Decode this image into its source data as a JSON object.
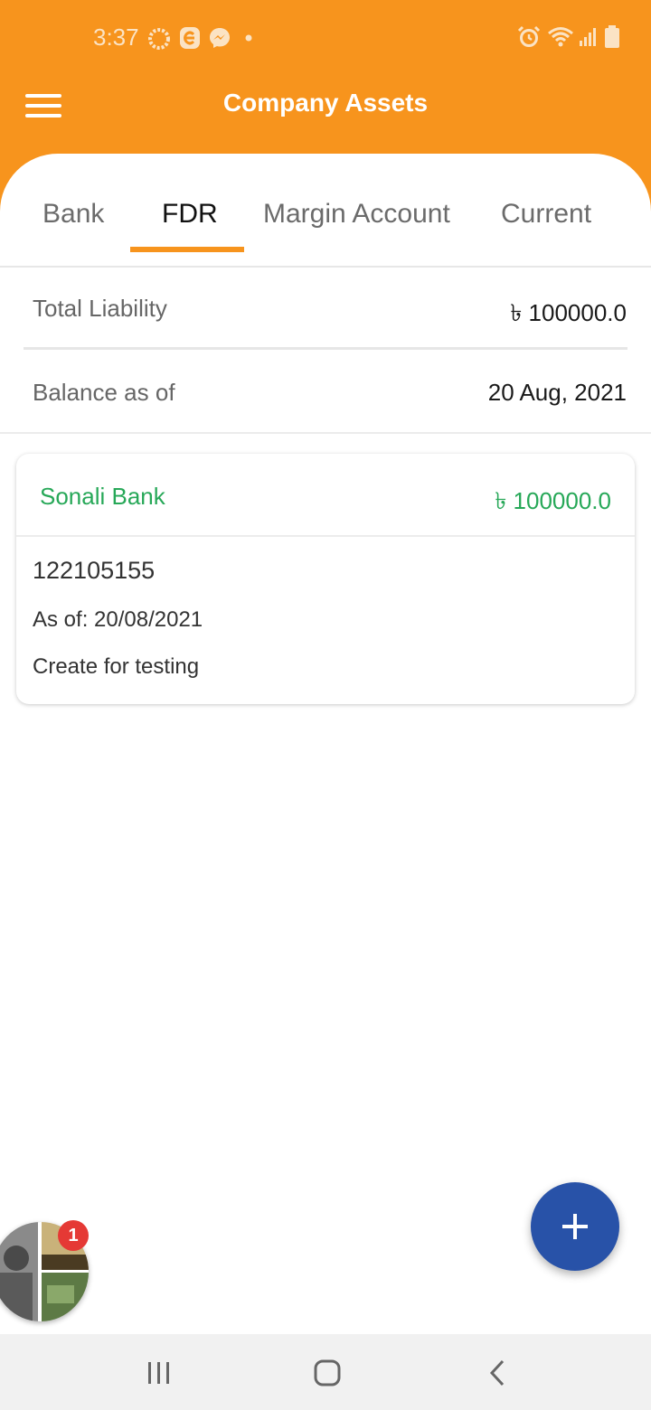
{
  "status_bar": {
    "time": "3:37",
    "left_icons": [
      "loading-ring-icon",
      "e-app-icon",
      "messenger-icon",
      "dot-icon"
    ],
    "right_icons": [
      "alarm-icon",
      "wifi-icon",
      "signal-icon",
      "battery-icon"
    ]
  },
  "app_bar": {
    "title": "Company Assets",
    "menu_icon": "hamburger-menu-icon",
    "color": "#F7941D"
  },
  "tabs": [
    {
      "label": "Bank",
      "active": false
    },
    {
      "label": "FDR",
      "active": true
    },
    {
      "label": "Margin Account",
      "active": false
    },
    {
      "label": "Current",
      "active": false
    }
  ],
  "summary": {
    "total_liability_label": "Total Liability",
    "total_liability_value": "৳ 100000.0",
    "balance_label": "Balance as of",
    "balance_date": "20 Aug, 2021"
  },
  "records": [
    {
      "bank": "Sonali Bank",
      "amount": "৳ 100000.0",
      "account_number": "122105155",
      "as_of": "As of: 20/08/2021",
      "note": "Create for testing"
    }
  ],
  "fab": {
    "icon": "plus-icon",
    "color": "#2852A8"
  },
  "chat_head": {
    "badge_count": "1"
  },
  "nav_bar": {
    "icons": [
      "recent-apps-icon",
      "home-icon",
      "back-icon"
    ]
  },
  "colors": {
    "accent": "#F7941D",
    "positive": "#27A858"
  }
}
